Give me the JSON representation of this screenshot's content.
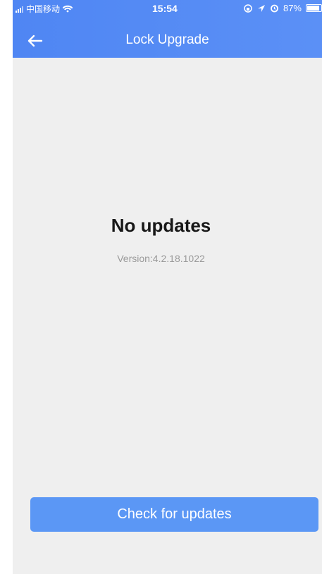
{
  "status_bar": {
    "carrier": "中国移动",
    "time": "15:54",
    "battery": "87%"
  },
  "header": {
    "title": "Lock Upgrade",
    "back_icon": "back-arrow-icon"
  },
  "main": {
    "status_message": "No updates",
    "version": "Version:4.2.18.1022"
  },
  "actions": {
    "check_updates_label": "Check for updates"
  },
  "colors": {
    "header": "#4f86f3",
    "button": "#5b97f5",
    "background": "#efefef"
  }
}
